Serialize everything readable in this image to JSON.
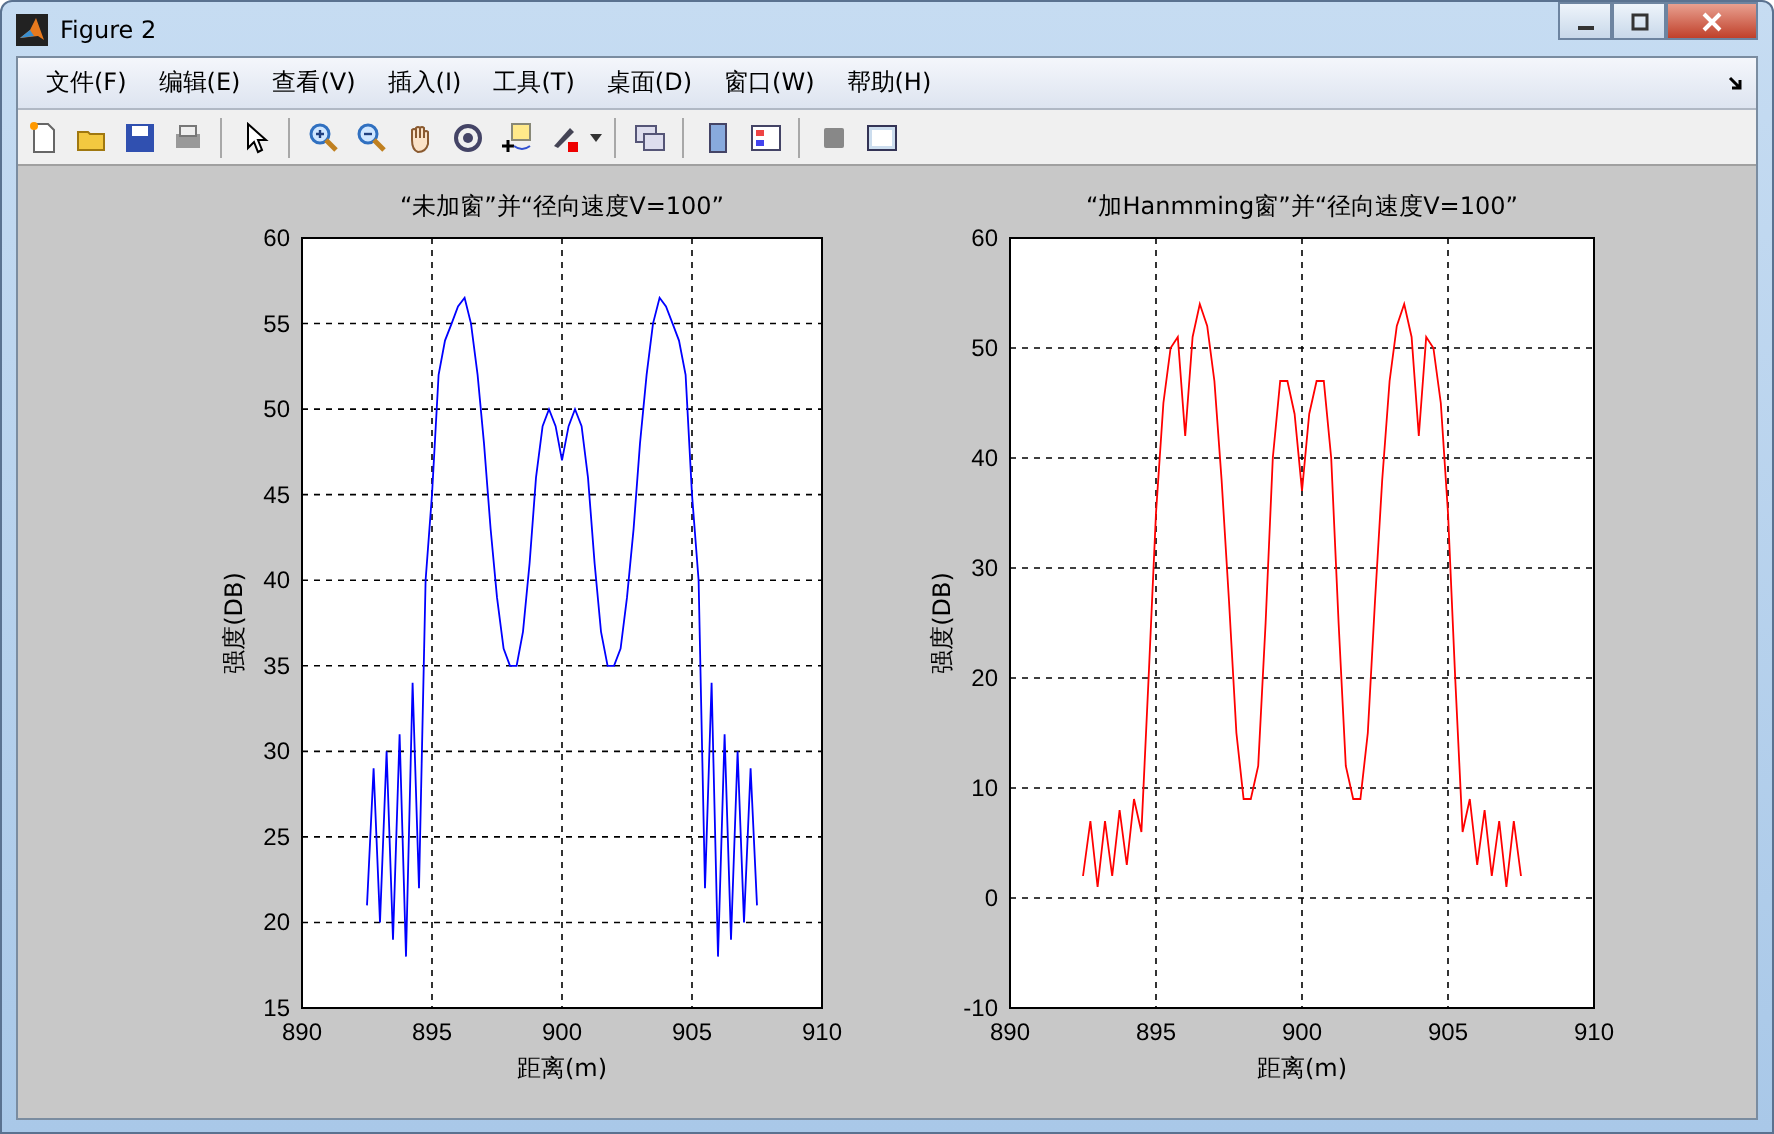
{
  "window": {
    "title": "Figure 2"
  },
  "menu": [
    "文件(F)",
    "编辑(E)",
    "查看(V)",
    "插入(I)",
    "工具(T)",
    "桌面(D)",
    "窗口(W)",
    "帮助(H)"
  ],
  "plots": [
    {
      "chart_data": {
        "type": "line",
        "grid": true,
        "title": "“未加窗”并“径向速度V=100”",
        "xlabel": "距离(m)",
        "ylabel": "强度(DB)",
        "xlim": [
          890,
          910
        ],
        "ylim": [
          15,
          60
        ],
        "xticks": [
          890,
          895,
          900,
          905,
          910
        ],
        "yticks": [
          15,
          20,
          25,
          30,
          35,
          40,
          45,
          50,
          55,
          60
        ],
        "x": [
          892.5,
          892.75,
          893,
          893.25,
          893.5,
          893.75,
          894,
          894.25,
          894.5,
          894.75,
          895,
          895.25,
          895.5,
          895.75,
          896,
          896.25,
          896.5,
          896.75,
          897,
          897.25,
          897.5,
          897.75,
          898,
          898.25,
          898.5,
          898.75,
          899,
          899.25,
          899.5,
          899.75,
          900,
          900.25,
          900.5,
          900.75,
          901,
          901.25,
          901.5,
          901.75,
          902,
          902.25,
          902.5,
          902.75,
          903,
          903.25,
          903.5,
          903.75,
          904,
          904.25,
          904.5,
          904.75,
          905,
          905.25,
          905.5,
          905.75,
          906,
          906.25,
          906.5,
          906.75,
          907,
          907.25,
          907.5
        ],
        "series": [
          {
            "color": "#0000ff",
            "values": [
              21,
              29,
              20,
              30,
              19,
              31,
              18,
              34,
              22,
              40,
              45,
              52,
              54,
              55,
              56,
              56.5,
              55,
              52,
              48,
              43,
              39,
              36,
              35,
              35,
              37,
              41,
              46,
              49,
              50,
              49,
              47,
              49,
              50,
              49,
              46,
              41,
              37,
              35,
              35,
              36,
              39,
              43,
              48,
              52,
              55,
              56.5,
              56,
              55,
              54,
              52,
              45,
              40,
              22,
              34,
              18,
              31,
              19,
              30,
              20,
              29,
              21
            ]
          }
        ]
      }
    },
    {
      "chart_data": {
        "type": "line",
        "grid": true,
        "title": "“加Hanmming窗”并“径向速度V=100”",
        "xlabel": "距离(m)",
        "ylabel": "强度(DB)",
        "xlim": [
          890,
          910
        ],
        "ylim": [
          -10,
          60
        ],
        "xticks": [
          890,
          895,
          900,
          905,
          910
        ],
        "yticks": [
          -10,
          0,
          10,
          20,
          30,
          40,
          50,
          60
        ],
        "x": [
          892.5,
          892.75,
          893,
          893.25,
          893.5,
          893.75,
          894,
          894.25,
          894.5,
          894.75,
          895,
          895.25,
          895.5,
          895.75,
          896,
          896.25,
          896.5,
          896.75,
          897,
          897.25,
          897.5,
          897.75,
          898,
          898.25,
          898.5,
          898.75,
          899,
          899.25,
          899.5,
          899.75,
          900,
          900.25,
          900.5,
          900.75,
          901,
          901.25,
          901.5,
          901.75,
          902,
          902.25,
          902.5,
          902.75,
          903,
          903.25,
          903.5,
          903.75,
          904,
          904.25,
          904.5,
          904.75,
          905,
          905.25,
          905.5,
          905.75,
          906,
          906.25,
          906.5,
          906.75,
          907,
          907.25,
          907.5
        ],
        "series": [
          {
            "color": "#ff0000",
            "values": [
              2,
              7,
              1,
              7,
              2,
              8,
              3,
              9,
              6,
              20,
              35,
              45,
              50,
              51,
              42,
              51,
              54,
              52,
              47,
              38,
              27,
              15,
              9,
              9,
              12,
              25,
              40,
              47,
              47,
              44,
              37,
              44,
              47,
              47,
              40,
              25,
              12,
              9,
              9,
              15,
              27,
              38,
              47,
              52,
              54,
              51,
              42,
              51,
              50,
              45,
              35,
              20,
              6,
              9,
              3,
              8,
              2,
              7,
              1,
              7,
              2
            ]
          }
        ]
      }
    }
  ]
}
